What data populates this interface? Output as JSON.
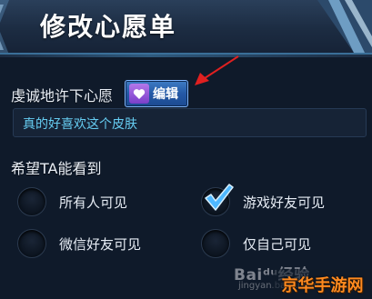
{
  "header": {
    "title": "修改心愿单"
  },
  "wish": {
    "label": "虔诚地许下心愿",
    "edit_button_label": "编辑",
    "text": "真的好喜欢这个皮肤"
  },
  "visibility": {
    "label": "希望TA能看到",
    "options": [
      {
        "label": "所有人可见",
        "selected": false
      },
      {
        "label": "游戏好友可见",
        "selected": true
      },
      {
        "label": "微信好友可见",
        "selected": false
      },
      {
        "label": "仅自己可见",
        "selected": false
      }
    ]
  },
  "watermark": {
    "baidu": "Baiᵈᵘ经验",
    "url": "jingyan.baidu.com",
    "site": "京华手游网"
  },
  "colors": {
    "accent": "#2f6bc0",
    "input_text": "#66cdf2",
    "annotation": "#e02020"
  }
}
